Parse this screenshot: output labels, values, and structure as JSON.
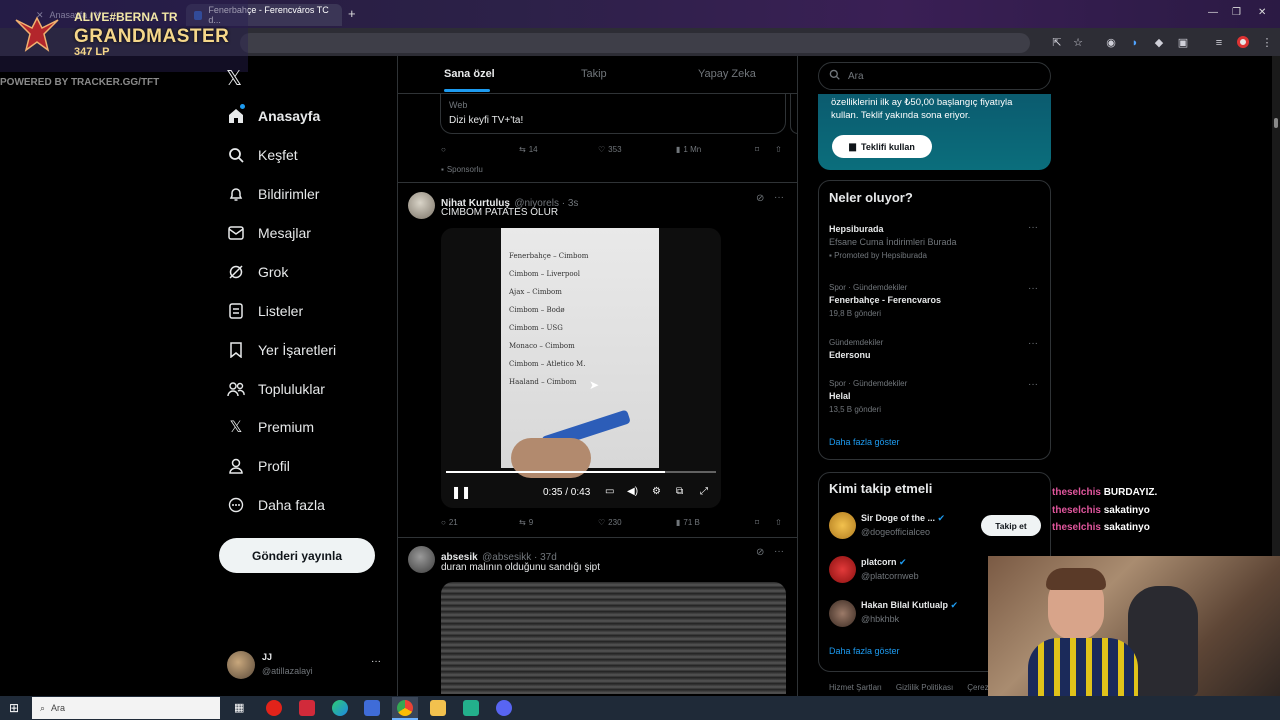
{
  "browser": {
    "tabs": [
      {
        "label": "Anasayfa / X"
      },
      {
        "label": "Fenerbahçe - Ferencváros TC d..."
      }
    ],
    "new_tab_symbol": "+"
  },
  "overlay": {
    "name": "ALIVE#BERNA TR",
    "rank": "GRANDMASTER",
    "lp": "347 LP",
    "powered_by": "POWERED BY TRACKER.GG/TFT"
  },
  "nav": {
    "items": [
      {
        "label": "Anasayfa",
        "icon": "home-icon"
      },
      {
        "label": "Keşfet",
        "icon": "search-icon"
      },
      {
        "label": "Bildirimler",
        "icon": "bell-icon"
      },
      {
        "label": "Mesajlar",
        "icon": "mail-icon"
      },
      {
        "label": "Grok",
        "icon": "grok-icon"
      },
      {
        "label": "Listeler",
        "icon": "list-icon"
      },
      {
        "label": "Yer İşaretleri",
        "icon": "bookmark-icon"
      },
      {
        "label": "Topluluklar",
        "icon": "communities-icon"
      },
      {
        "label": "Premium",
        "icon": "x-logo-icon"
      },
      {
        "label": "Profil",
        "icon": "person-icon"
      },
      {
        "label": "Daha fazla",
        "icon": "more-circle-icon"
      }
    ],
    "post_button": "Gönderi yayınla",
    "account": {
      "name": "JJ",
      "handle": "@atillazalayi"
    }
  },
  "feed": {
    "tabs": [
      "Sana özel",
      "Takip",
      "Yapay Zeka"
    ],
    "ad": {
      "card_label": "Web",
      "card_text": "Dizi keyfi TV+'ta!",
      "retweets": "14",
      "likes": "353",
      "views": "1 Mn",
      "sponsored": "Sponsorlu"
    },
    "tweet1": {
      "name": "Nihat Kurtuluş",
      "handle": "@niyorels · 3s",
      "text": "CİMBOM PATATES OLUR",
      "video_time": "0:35 / 0:43",
      "progress": 0.81,
      "paper_lines": [
        "Fenerbahçe – Cimbom",
        "Cimbom – Liverpool",
        "Ajax – Cimbom",
        "Cimbom – Bodø",
        "Cimbom – USG",
        "Monaco – Cimbom",
        "Cimbom – Atletico M.",
        "Haaland – Cimbom"
      ],
      "replies": "21",
      "retweets": "9",
      "likes": "230",
      "views": "71 B"
    },
    "tweet2": {
      "name": "absesik",
      "handle": "@absesikk · 37d",
      "text": "duran malının olduğunu sandığı şipt"
    }
  },
  "right": {
    "search_placeholder": "Ara",
    "promo": {
      "text": "özelliklerini ilk ay ₺50,00 başlangıç fiyatıyla kullan. Teklif yakında sona eriyor.",
      "button": "Teklifi kullan"
    },
    "trends": {
      "title": "Neler oluyor?",
      "items": [
        {
          "meta": "",
          "title": "Hepsiburada",
          "sub": "Efsane Cuma İndirimleri Burada",
          "extra": "Promoted by Hepsiburada"
        },
        {
          "meta": "Spor · Gündemdekiler",
          "title": "Fenerbahçe - Ferencvaros",
          "sub": "19,8 B gönderi",
          "extra": ""
        },
        {
          "meta": "Gündemdekiler",
          "title": "Edersonu",
          "sub": "",
          "extra": ""
        },
        {
          "meta": "Spor · Gündemdekiler",
          "title": "Helal",
          "sub": "13,5 B gönderi",
          "extra": ""
        }
      ],
      "show_more": "Daha fazla göster"
    },
    "follow": {
      "title": "Kimi takip etmeli",
      "users": [
        {
          "name": "Sir Doge of the ...",
          "handle": "@dogeofficialceo"
        },
        {
          "name": "platcorn",
          "handle": "@platcornweb"
        },
        {
          "name": "Hakan Bilal Kutlualp",
          "handle": "@hbkhbk"
        }
      ],
      "follow_button": "Takip et",
      "show_more": "Daha fazla göster"
    },
    "footer": [
      "Hizmet Şartları",
      "Gizlilik Politikası",
      "Çerez P"
    ]
  },
  "chat": [
    {
      "user": "theselchis",
      "msg": "BURDAYIZ."
    },
    {
      "user": "theselchis",
      "msg": "sakatinyo"
    },
    {
      "user": "theselchis",
      "msg": "sakatinyo"
    }
  ],
  "taskbar": {
    "search_placeholder": "Ara"
  }
}
